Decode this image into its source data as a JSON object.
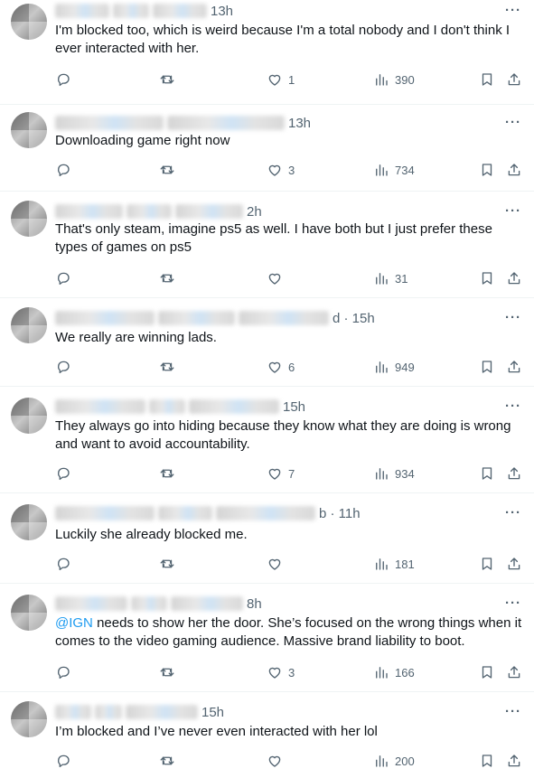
{
  "tweets": [
    {
      "time": "13h",
      "text": "I'm blocked too, which is weird because I'm a total nobody and I don't think I ever interacted with her.",
      "replies": "",
      "reposts": "",
      "likes": "1",
      "views": "390"
    },
    {
      "time": "13h",
      "text": "Downloading game right now",
      "replies": "",
      "reposts": "",
      "likes": "3",
      "views": "734"
    },
    {
      "time": "2h",
      "text": "That's only steam, imagine ps5 as well. I have both but I just prefer these types of games on ps5",
      "replies": "",
      "reposts": "",
      "likes": "",
      "views": "31"
    },
    {
      "time": "d · 15h",
      "text": "We really are winning lads.",
      "replies": "",
      "reposts": "",
      "likes": "6",
      "views": "949"
    },
    {
      "time": "15h",
      "text": "They always go into hiding because they know what they are doing is wrong and want to avoid accountability.",
      "replies": "",
      "reposts": "",
      "likes": "7",
      "views": "934"
    },
    {
      "time": "b · 11h",
      "text": "Luckily she already blocked me.",
      "replies": "",
      "reposts": "",
      "likes": "",
      "views": "181"
    },
    {
      "time": "8h",
      "mention": "@IGN",
      "text": " needs to show her the door. She’s focused on the wrong things when it comes to the video gaming audience. Massive brand liability to boot.",
      "replies": "",
      "reposts": "",
      "likes": "3",
      "views": "166"
    },
    {
      "time": "15h",
      "text": "I’m blocked and I’ve never even interacted with her lol",
      "replies": "",
      "reposts": "",
      "likes": "",
      "views": "200"
    }
  ],
  "icons": {
    "reply": "reply-icon",
    "repost": "repost-icon",
    "like": "heart-icon",
    "views": "views-icon",
    "bookmark": "bookmark-icon",
    "share": "share-icon",
    "more": "more-icon"
  },
  "more_glyph": "···",
  "colors": {
    "text": "#0f1419",
    "secondary": "#536471",
    "accent": "#1d9bf0",
    "divider": "#eff3f4"
  }
}
